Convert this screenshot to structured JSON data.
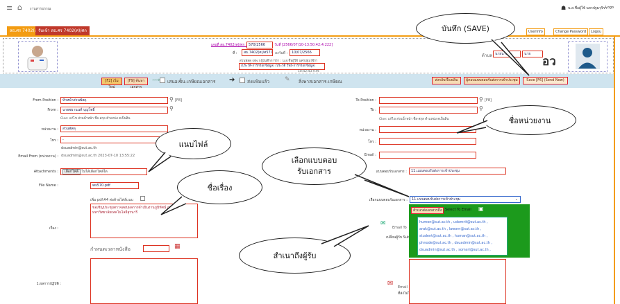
{
  "topbar": {
    "home_label": "งานสารบรรณ",
    "user_label": "น.ส.ชื่อผู้ใช้ นครปฐมรุจิรา",
    "logout_label": "Logo"
  },
  "tabs": {
    "tab1": "สธ.ศร 7402(ศ)/ศก",
    "tab2": "รับเข้า สธ.ศร 7402(ศ)/ศก"
  },
  "right_links": {
    "notify": "Userinfo",
    "change_password": "Change Password",
    "logout": "Logou"
  },
  "header": {
    "doc_label": "เลขที่ สธ.7402(ศ)/ศก :",
    "doc_no": "570/2566",
    "date_line": "วันที่ [2566/07/10-13:50:42:4:222]",
    "ref_label": "ที่ : สธ.7402(ศ)/ศ570",
    "ref_date_label": "ลงวันที่ :",
    "ref_date": "10/07/2566",
    "office_line": "ส่วนพัสดุ (สพ.) ผู้บันทึกการรา : น.ส.ชื่อผู้ใช้ นครปฐมรุจิรา",
    "status_line": "(ประวัติ-การกรอกข้อมูล) (ประวัติ วิทย์-การกรอกข้อมูล)",
    "time": "10:42:43 A.M.",
    "right_label": "ด้านหลา :",
    "right_field1": "นายนาย",
    "right_field2": "นาย",
    "initials": "อว"
  },
  "toolbar": {
    "new_btn": "[F2] เริ่มใหม่",
    "search_btn": "[F9] ค้นหาเอกสาร",
    "check1_label": "เสนอเซ็น-เกษียณเอกสาร",
    "check2_label": "ส่งแฟ้มแล้ว",
    "check3_label": "สิ่งพาสเอกสาร-เกษียณ",
    "resend_btn": "ส่งกลับเรื่องเดิม",
    "choose_btn": "ผู้ตอบแบบตอบรับส่งการเข้าประชุม",
    "save_btn": "Save [F6] (Send Now)"
  },
  "form_left": {
    "from_position_label": "From Position :",
    "from_position": "หัวหน้าส่วนพัสดุ",
    "f8": "[F8]",
    "from_label": "From :",
    "from": "นายชยานนท์ บุญโพธิ์",
    "from_sub": "Cloe: แก้ไข ส่วนน้ำหน้า ชื่อ-สกุล ตำแหน่ง ตเป็นสิน",
    "unit_label": "หน่วยงาน :",
    "unit": "ส่วนพัสดุ",
    "tel_label": "โทร :",
    "tel": "-",
    "email_label": "Email From (หน่วยงาน) :",
    "email1": "dsuadmin@sut.ac.th",
    "email2": "dsuadmin@sut.ac.th 2023-07-10 13:55:22",
    "attach_label": "Attachments :",
    "attach_btn": "เลือกไฟล์",
    "attach_none": "ไม่ได้เลือกไฟล์ใด",
    "filename_label": "File Name :",
    "filename": "ws570.pdf",
    "pdf_label": "เพิ่ม pdf-A4 ต่อท้ายไฟล์แนบ",
    "subject_label": "เรื่อง :",
    "subject": "ขอเชิญประชุมตรวจสอบผลการดำเนินงานภูมิทัศน์ ภายในมหาวิทยาลัยเทคโนโลยีสุรนารี",
    "deadline_label": "กำหนดเวลาหนังสือ",
    "practice_label": "1.ผลการปฏิบัติ :"
  },
  "form_right": {
    "to_position_label": "To Position :",
    "to_label": "To :",
    "to_sub": "Cloe: แก้ไข ส่วนน้ำหน้า ชื่อ-สกุล ตำแหน่ง ตเป็นสิน",
    "unit_label": "หน่วยงาน :",
    "tel_label": "โทร :",
    "email_label": "Email :",
    "reply_label": "แบบตอบรับเอกสาร :",
    "reply_value": "11.แบบตอบรับส่งการเข้าประชุม",
    "select_label": "เลือกแบบตอบรับเอกสาร :",
    "select_value": "11.แบบตอบรับส่งการเข้าประชุม",
    "email_to_label": "Email To",
    "subject_short": "เปลี่ยนผู้รับ Subject",
    "cc_title": "สำเนาส่งเอกสารถึง",
    "cc_select_label": "Select To Email",
    "cc_lines": [
      "humon@sut.ac.th ,  udomrit@sut.ac.th ,",
      "arak@sut.ac.th ,  laworn@sut.ac.th ,",
      "student@sut.ac.th ,  human@sut.ac.th ,",
      "phnode@sut.ac.th ,  dsuadmin@sut.ac.th ,",
      "dsuadmin@sut.ac.th ,  somsri@sut.ac.th ,"
    ],
    "email_bottom": "Email",
    "email_bottom2": "ที่ส่งไม่ได้"
  },
  "bubbles": {
    "save": "บันทึก (SAVE)",
    "unit": "ชื่อหน่วยงาน",
    "attach": "แนบไฟล์",
    "reply": "เลือกแบบตอบ\nรับเอกสาร",
    "subject": "ชื่อเรื่อง",
    "cc": "สำเนาถึงผู้รับ"
  },
  "colors": {
    "accent": "#f39c12",
    "toolbar": "#cfe4ef",
    "green": "#1c9a1c"
  }
}
